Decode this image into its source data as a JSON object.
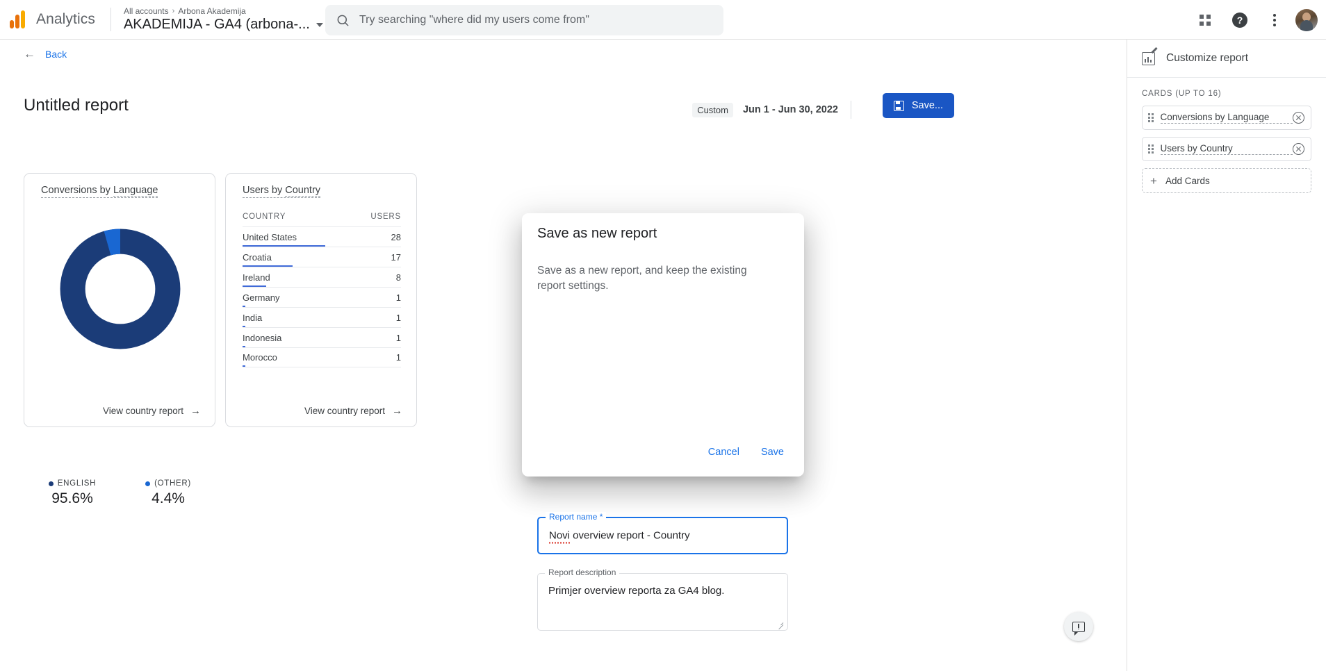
{
  "topbar": {
    "brand": "Analytics",
    "account_breadcrumb_root": "All accounts",
    "account_breadcrumb_sep": "›",
    "account_breadcrumb_name": "Arbona Akademija",
    "property_name": "AKADEMIJA - GA4 (arbona-...",
    "search_placeholder": "Try searching \"where did my users come from\"",
    "icons": {
      "search": "search-icon",
      "apps": "apps-grid-icon",
      "help": "help-icon",
      "more": "more-vert-icon",
      "avatar": "user-avatar"
    }
  },
  "page": {
    "back_label": "Back",
    "back_icon": "arrow-left-icon",
    "title": "Untitled report",
    "date_range_type": "Custom",
    "date_range": "Jun 1 - Jun 30, 2022",
    "save_button": "Save...",
    "save_icon": "floppy-disk-icon"
  },
  "cards": [
    {
      "title_part1": "Conversions by",
      "title_part2": "Language",
      "link": "View country report",
      "link_icon": "arrow-right-icon"
    },
    {
      "title_part1": "Users by",
      "title_part2": "Country",
      "link": "View country report",
      "link_icon": "arrow-right-icon"
    }
  ],
  "chart_data": [
    {
      "type": "pie",
      "title": "Conversions by Language",
      "labels": [
        "ENGLISH",
        "(OTHER)"
      ],
      "values": [
        95.6,
        4.4
      ],
      "value_labels": [
        "95.6%",
        "4.4%"
      ],
      "colors": [
        "#1b3c78",
        "#1967d2"
      ],
      "donut": true,
      "legend": "bottom"
    },
    {
      "type": "table",
      "title": "Users by Country",
      "columns": [
        "COUNTRY",
        "USERS"
      ],
      "rows": [
        {
          "country": "United States",
          "users": 28
        },
        {
          "country": "Croatia",
          "users": 17
        },
        {
          "country": "Ireland",
          "users": 8
        },
        {
          "country": "Germany",
          "users": 1
        },
        {
          "country": "India",
          "users": 1
        },
        {
          "country": "Indonesia",
          "users": 1
        },
        {
          "country": "Morocco",
          "users": 1
        }
      ],
      "bar_color": "#3f6ad8",
      "bar_max": 28
    }
  ],
  "right_panel": {
    "heading": "Customize report",
    "heading_icon": "chart-edit-icon",
    "cards_label": "CARDS (UP TO 16)",
    "cards": [
      {
        "label": "Conversions by Language",
        "drag_icon": "drag-handle-icon",
        "remove_icon": "remove-circle-icon"
      },
      {
        "label": "Users by Country",
        "drag_icon": "drag-handle-icon",
        "remove_icon": "remove-circle-icon"
      }
    ],
    "add_cards_label": "Add Cards",
    "add_cards_icon": "plus-icon"
  },
  "dialog": {
    "title": "Save as new report",
    "description": "Save as a new report, and keep the existing report settings.",
    "name_label": "Report name *",
    "name_value_misspelled": "Novi",
    "name_value_rest": " overview report - Country",
    "desc_label": "Report description",
    "desc_value": "Primjer overview reporta za GA4 blog.",
    "cancel": "Cancel",
    "save": "Save"
  },
  "feedback": {
    "icon": "feedback-icon"
  },
  "colors": {
    "accent_blue": "#1a73e8",
    "save_button_blue": "#1a56c4",
    "donut_primary": "#1b3c78",
    "donut_other": "#1967d2",
    "bar_blue": "#3f6ad8",
    "error_red": "#d93025"
  }
}
